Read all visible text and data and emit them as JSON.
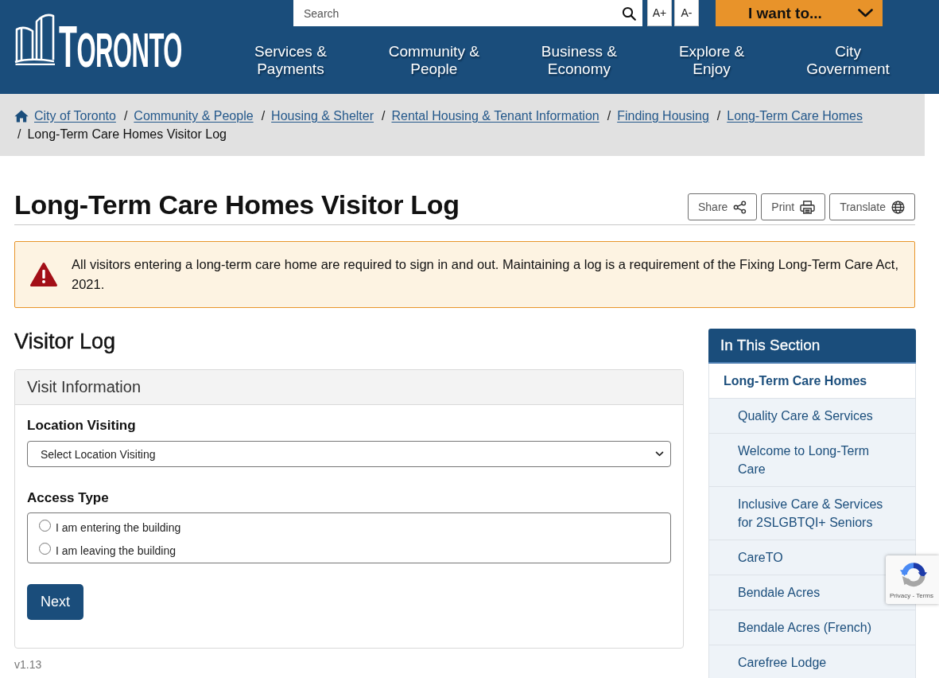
{
  "header": {
    "logo_text": "TORONTO",
    "search": {
      "placeholder": "Search"
    },
    "text_size_buttons": [
      "A+",
      "A-"
    ],
    "i_want_to": "I want to...",
    "nav": [
      {
        "lines": [
          "Services &",
          "Payments"
        ]
      },
      {
        "lines": [
          "Community &",
          "People"
        ]
      },
      {
        "lines": [
          "Business &",
          "Economy"
        ]
      },
      {
        "lines": [
          "Explore &",
          "Enjoy"
        ]
      },
      {
        "lines": [
          "City",
          "Government"
        ]
      }
    ]
  },
  "breadcrumb": {
    "links": [
      {
        "label": "City of Toronto"
      },
      {
        "separator": "/",
        "label": "Community & People"
      },
      {
        "separator": "/",
        "label": "Housing & Shelter"
      },
      {
        "separator": "/",
        "label": "Rental Housing & Tenant Information"
      },
      {
        "separator": "/",
        "label": "Finding Housing"
      },
      {
        "separator": "/",
        "label": "Long-Term Care Homes"
      }
    ],
    "current": {
      "separator": "/",
      "label": "Long-Term Care Homes Visitor Log"
    }
  },
  "page": {
    "title": "Long-Term Care Homes Visitor Log",
    "actions": [
      {
        "kind": "share",
        "label": "Share"
      },
      {
        "kind": "print",
        "label": "Print"
      },
      {
        "kind": "translate",
        "label": "Translate"
      }
    ]
  },
  "alert": {
    "text": "All visitors entering a long-term care home are required to sign in and out. Maintaining a log is a requirement of the Fixing Long-Term Care Act, 2021."
  },
  "form": {
    "heading": "Visitor Log",
    "card_title": "Visit Information",
    "location": {
      "label": "Location Visiting",
      "value": "Select Location Visiting"
    },
    "access_type": {
      "label": "Access Type",
      "options": [
        {
          "label": "I am entering the building",
          "selected": false
        },
        {
          "label": "I am leaving the building",
          "selected": false
        }
      ]
    },
    "next_button": "Next"
  },
  "version": "v1.13",
  "sidebar": {
    "title": "In This Section",
    "parent": "Long-Term Care Homes",
    "items": [
      {
        "label": "Quality Care & Services"
      },
      {
        "label": "Welcome to Long-Term Care"
      },
      {
        "label": "Inclusive Care & Services for 2SLGBTQI+ Seniors"
      },
      {
        "label": "CareTO"
      },
      {
        "label": "Bendale Acres"
      },
      {
        "label": "Bendale Acres (French)"
      },
      {
        "label": "Carefree Lodge"
      }
    ]
  },
  "recaptcha_badge": {
    "links": "Privacy - Terms"
  }
}
